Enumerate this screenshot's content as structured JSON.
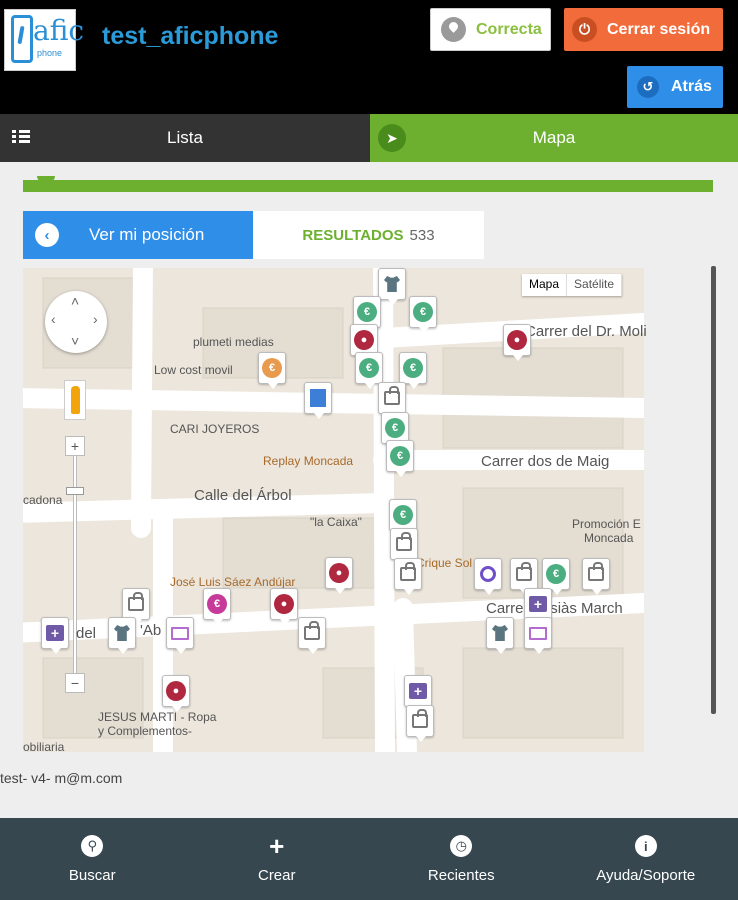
{
  "header": {
    "logo_text": "afic",
    "logo_sub": "phone",
    "title": "test_aficphone",
    "correcta_label": "Correcta",
    "cerrar_label": "Cerrar sesión",
    "atras_label": "Atrás"
  },
  "tabs": [
    {
      "label": "Lista"
    },
    {
      "label": "Mapa"
    }
  ],
  "position": {
    "button_label": "Ver mi posición",
    "results_label": "RESULTADOS",
    "results_count": "533"
  },
  "map": {
    "type_options": [
      "Mapa",
      "Satélite"
    ],
    "labels": [
      "plumeti medias",
      "Low cost movil",
      "CARI JOYEROS",
      "Replay Moncada",
      "Carrer dos de Maig",
      "Calle del Árbol",
      "\"la Caixa\"",
      "Promoción E",
      "Moncada",
      "José Luis Sáez Andújar",
      "Carrer Ausiàs March",
      "del",
      "'Ab",
      "JESUS MARTI - Ropa",
      "y Complementos-",
      "cadona",
      "obiliaria",
      "Carrer del Dr. Moli",
      "Crique Sol"
    ]
  },
  "user_line": "test- v4- m@m.com",
  "bottom_nav": [
    {
      "label": "Buscar",
      "icon": "search-icon"
    },
    {
      "label": "Crear",
      "icon": "plus-icon"
    },
    {
      "label": "Recientes",
      "icon": "clock-icon"
    },
    {
      "label": "Ayuda/Soporte",
      "icon": "info-icon"
    }
  ],
  "colors": {
    "accent_green": "#6db02f",
    "accent_blue": "#2f8fe8",
    "logout_orange": "#f26b3a",
    "title_blue": "#2a9bd8",
    "bottom_bar": "#37474f"
  }
}
